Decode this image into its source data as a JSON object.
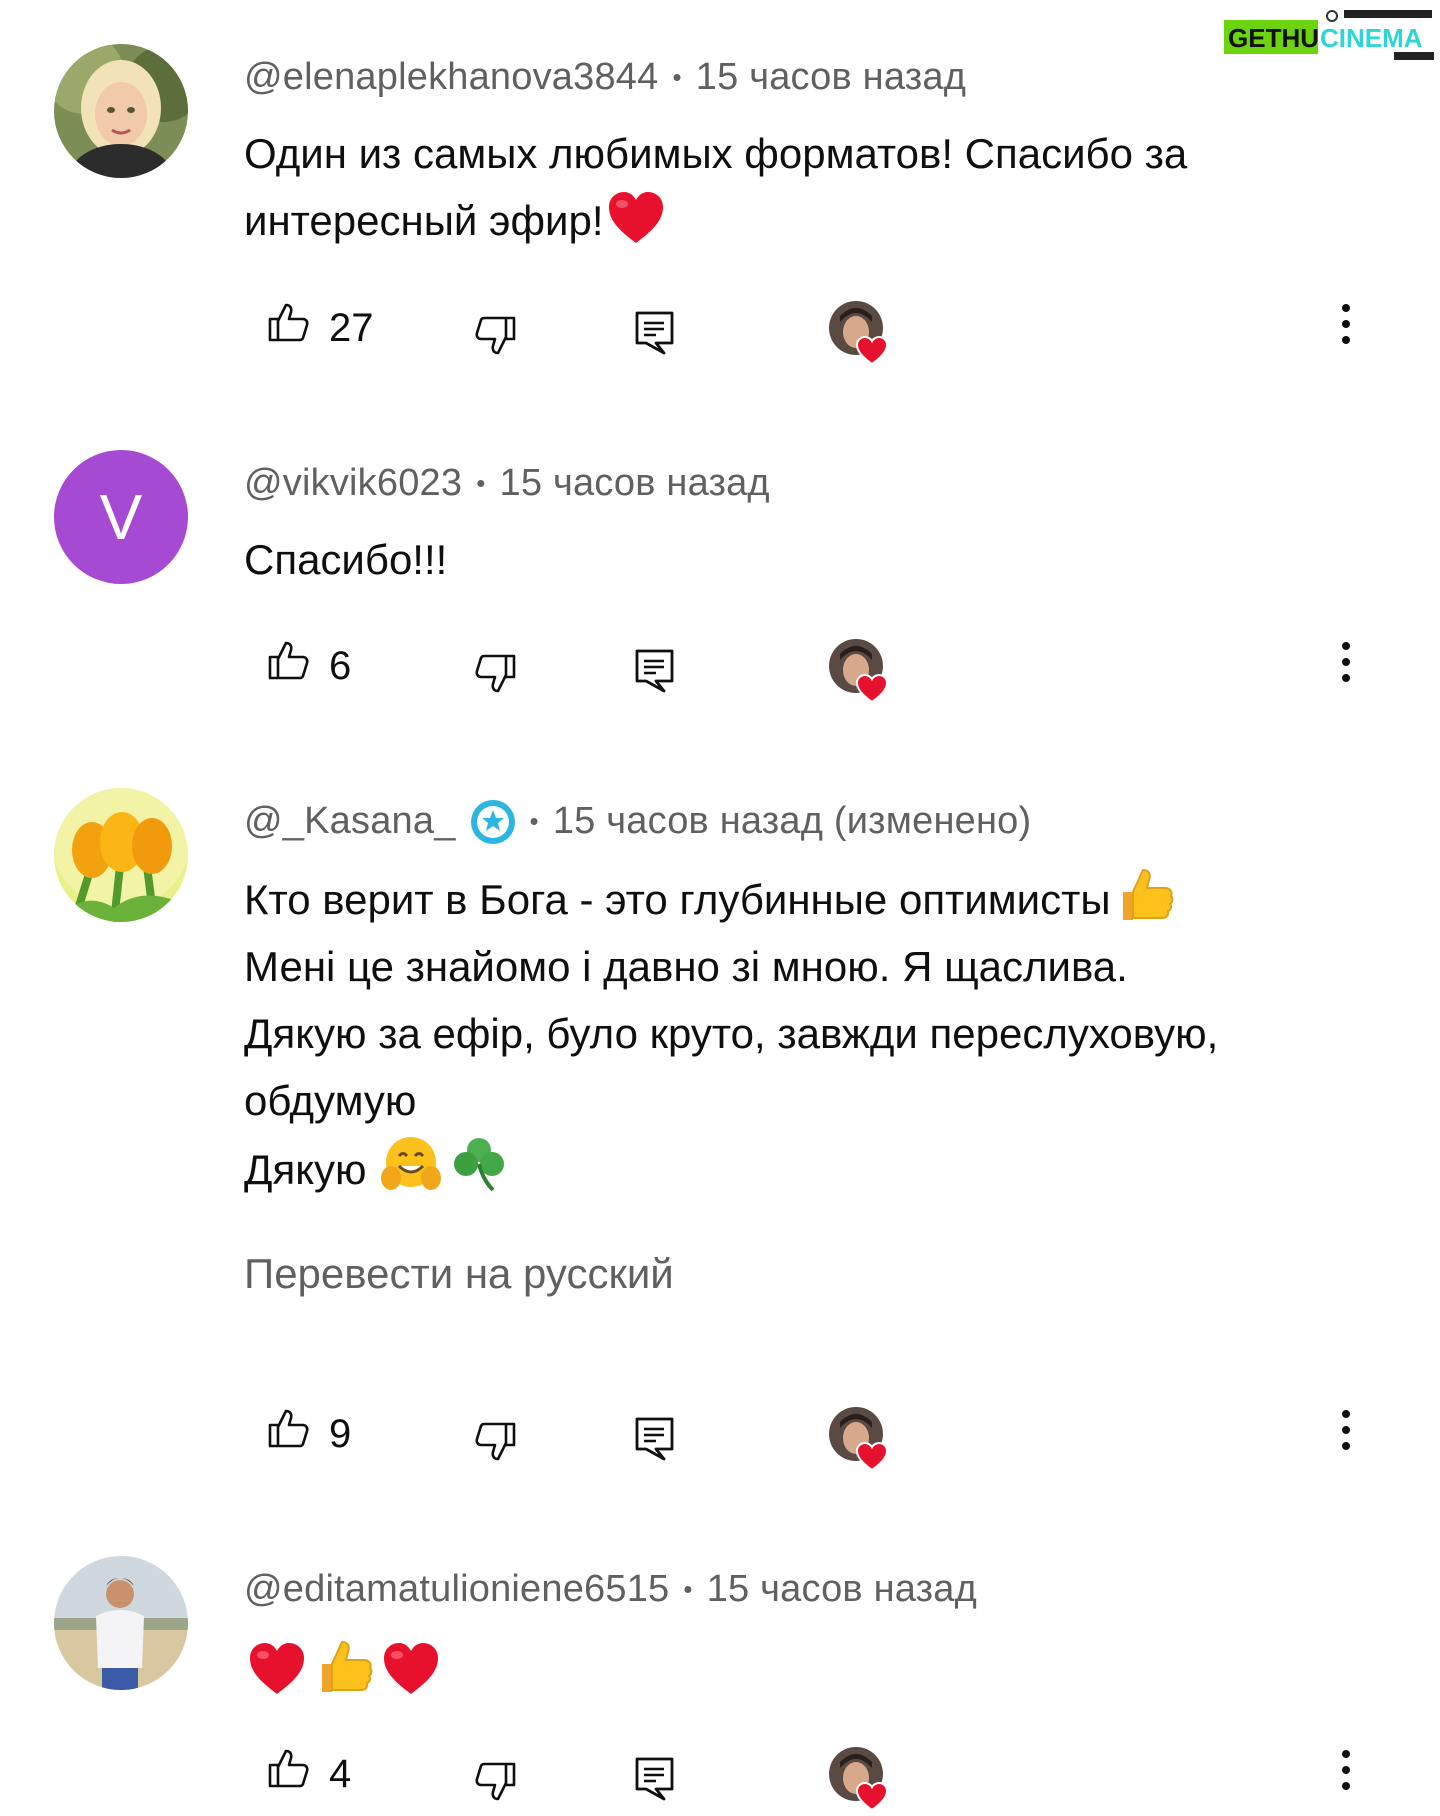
{
  "watermark": {
    "part1": "GETHU",
    "part2": "CINEMA"
  },
  "comments": [
    {
      "author": "@elenaplekhanova3844",
      "time": "15 часов назад",
      "lines": [
        "Один из самых любимых форматов! Спасибо за",
        "интересный эфир!"
      ],
      "likes": "27",
      "verified": false,
      "emojis": [
        "red-heart"
      ]
    },
    {
      "author": "@vikvik6023",
      "time": "15 часов назад",
      "avatar_letter": "V",
      "lines": [
        "Спасибо!!!"
      ],
      "likes": "6",
      "verified": false
    },
    {
      "author": "@_Kasana_",
      "time": "15 часов назад (изменено)",
      "lines": [
        "Кто верит в Бога - это глубинные оптимисты",
        "Мені це знайомо і давно зі мною. Я щаслива.",
        "Дякую за ефір, було круто, завжди переслуховую,",
        "обдумую",
        "Дякую"
      ],
      "translate": "Перевести на русский",
      "likes": "9",
      "verified": true,
      "emojis": [
        "thumbs-up",
        "hugging-face",
        "shamrock"
      ]
    },
    {
      "author": "@editamatulioniene6515",
      "time": "15 часов назад",
      "lines": [],
      "likes": "4",
      "verified": false,
      "emojis": [
        "red-heart",
        "thumbs-up",
        "red-heart"
      ]
    }
  ],
  "colors": {
    "meta_text": "#606060",
    "body_text": "#0f0f0f",
    "letter_avatar_bg": "#a74ad3",
    "verified_badge": "#2bb5e3",
    "heart": "#e8112d",
    "watermark_green": "#6cd40f",
    "watermark_cyan": "#2fd3d8"
  },
  "icons": {
    "like": "thumb-up-icon",
    "dislike": "thumb-down-icon",
    "reply": "reply-icon",
    "creator_heart": "creator-heart-icon",
    "more": "more-vert-icon"
  }
}
